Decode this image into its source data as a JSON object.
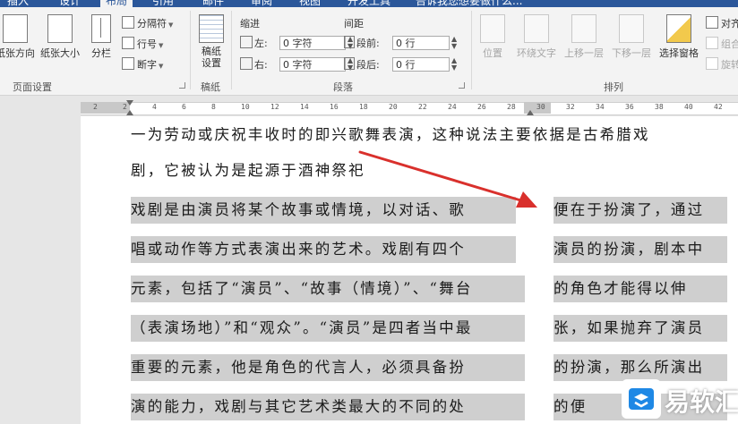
{
  "tabs": [
    {
      "label": "插入",
      "active": false
    },
    {
      "label": "设计",
      "active": false
    },
    {
      "label": "布局",
      "active": true
    },
    {
      "label": "引用",
      "active": false
    },
    {
      "label": "邮件",
      "active": false
    },
    {
      "label": "审阅",
      "active": false
    },
    {
      "label": "视图",
      "active": false
    },
    {
      "label": "开发工具",
      "active": false
    },
    {
      "label": "告诉我您想要做什么...",
      "active": false
    }
  ],
  "ribbon": {
    "page_setup": {
      "orientation": "纸张方向",
      "size": "纸张大小",
      "columns": "分栏",
      "breaks": "分隔符",
      "line_numbers": "行号",
      "hyphenation": "断字",
      "group_label": "页面设置"
    },
    "draft": {
      "button": "稿纸设置",
      "group_label": "稿纸"
    },
    "paragraph": {
      "indent_label": "缩进",
      "spacing_label": "间距",
      "left_label": "左:",
      "right_label": "右:",
      "before_label": "段前:",
      "after_label": "段后:",
      "left_value": "0 字符",
      "right_value": "0 字符",
      "before_value": "0 行",
      "after_value": "0 行",
      "group_label": "段落"
    },
    "arrange": {
      "position": "位置",
      "wrap_text": "环绕文字",
      "bring_forward": "上移一层",
      "send_backward": "下移一层",
      "selection_pane": "选择窗格",
      "align": "对齐",
      "group": "组合",
      "rotate": "旋转",
      "group_label": "排列"
    }
  },
  "ruler": {
    "ticks": [
      "2",
      "2",
      "4",
      "6",
      "8",
      "10",
      "12",
      "14",
      "16",
      "18",
      "20",
      "22",
      "24",
      "26",
      "28",
      "30",
      "32",
      "34",
      "36",
      "38",
      "40",
      "42"
    ]
  },
  "document": {
    "intro_lines": [
      "一为劳动或庆祝丰收时的即兴歌舞表演，这种说法主要依据是古希腊戏",
      "剧，它被认为是起源于酒神祭祀"
    ],
    "col1_lines": [
      "戏剧是由演员将某个故事或情境，以对话、歌",
      "唱或动作等方式表演出来的艺术。戏剧有四个",
      "元素，包括了“演员”、“故事（情境）”、“舞台",
      "（表演场地）”和“观众”。“演员”是四者当中最",
      "重要的元素，他是角色的代言人，必须具备扮",
      "演的能力，戏剧与其它艺术类最大的不同的处"
    ],
    "col2_lines": [
      "便在于扮演了，通过",
      "演员的扮演，剧本中",
      "的角色才能得以伸",
      "张，如果抛弃了演员",
      "的扮演，那么所演出",
      "的便"
    ]
  },
  "watermark": {
    "text": "易软汇"
  },
  "colors": {
    "ribbon_blue": "#2b579a",
    "annotation_arrow": "#d9302c",
    "highlight": "#cfcfcf"
  }
}
